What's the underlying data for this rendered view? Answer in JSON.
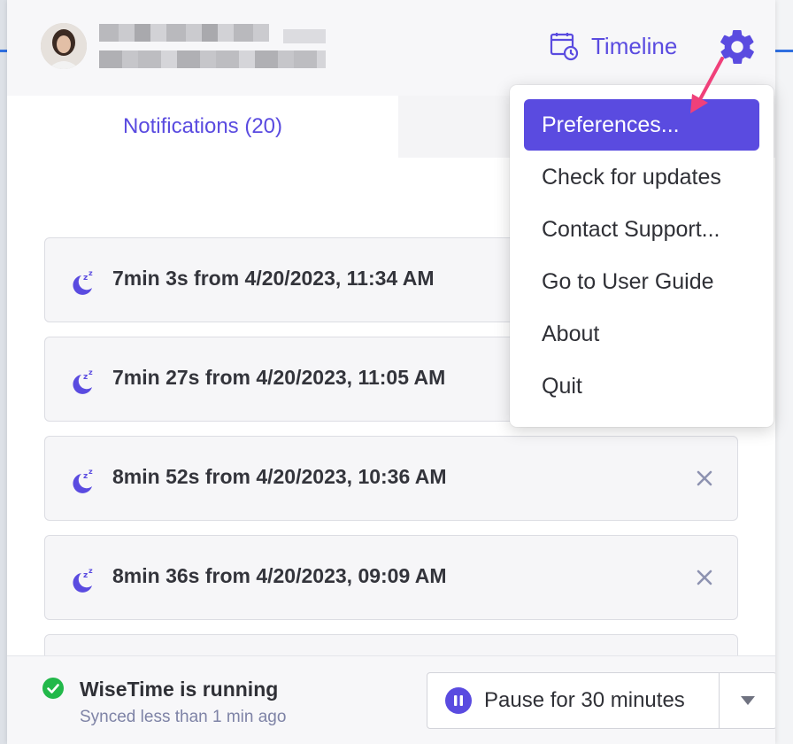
{
  "colors": {
    "accent": "#5a4be0",
    "success": "#22b84a",
    "annotation_arrow": "#f0407a"
  },
  "header": {
    "timeline_label": "Timeline",
    "timeline_icon": "calendar-clock-icon",
    "settings_icon": "gear-icon"
  },
  "tabs": {
    "notifications_label": "Notifications (20)"
  },
  "notifications": [
    {
      "text": "7min 3s from 4/20/2023, 11:34 AM",
      "icon": "sleep-zz-icon"
    },
    {
      "text": "7min 27s from 4/20/2023, 11:05 AM",
      "icon": "sleep-zz-icon"
    },
    {
      "text": "8min 52s from 4/20/2023, 10:36 AM",
      "icon": "sleep-zz-icon"
    },
    {
      "text": "8min 36s from 4/20/2023, 09:09 AM",
      "icon": "sleep-zz-icon"
    }
  ],
  "menu": {
    "items": [
      {
        "label": "Preferences..."
      },
      {
        "label": "Check for updates"
      },
      {
        "label": "Contact Support..."
      },
      {
        "label": "Go to User Guide"
      },
      {
        "label": "About"
      },
      {
        "label": "Quit"
      }
    ]
  },
  "footer": {
    "status_title": "WiseTime is running",
    "status_sub": "Synced less than 1 min ago",
    "pause_label": "Pause for 30 minutes"
  }
}
